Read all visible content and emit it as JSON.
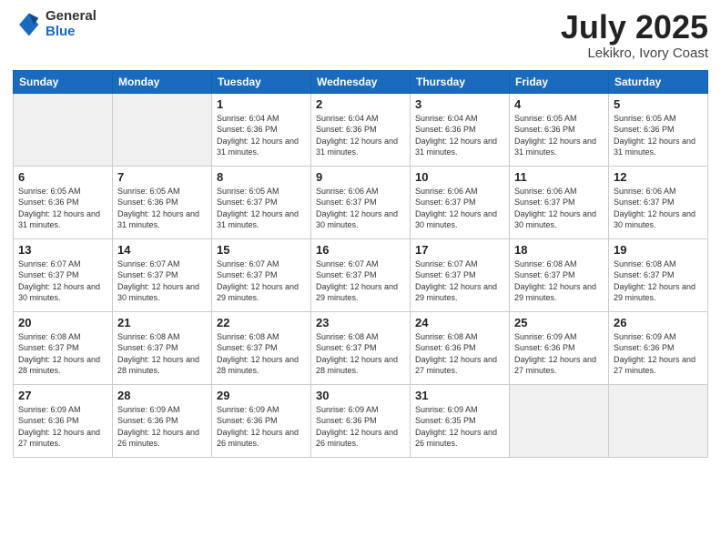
{
  "header": {
    "logo_general": "General",
    "logo_blue": "Blue",
    "title": "July 2025",
    "location": "Lekikro, Ivory Coast"
  },
  "weekdays": [
    "Sunday",
    "Monday",
    "Tuesday",
    "Wednesday",
    "Thursday",
    "Friday",
    "Saturday"
  ],
  "weeks": [
    [
      {
        "day": "",
        "empty": true
      },
      {
        "day": "",
        "empty": true
      },
      {
        "day": "1",
        "sunrise": "Sunrise: 6:04 AM",
        "sunset": "Sunset: 6:36 PM",
        "daylight": "Daylight: 12 hours and 31 minutes."
      },
      {
        "day": "2",
        "sunrise": "Sunrise: 6:04 AM",
        "sunset": "Sunset: 6:36 PM",
        "daylight": "Daylight: 12 hours and 31 minutes."
      },
      {
        "day": "3",
        "sunrise": "Sunrise: 6:04 AM",
        "sunset": "Sunset: 6:36 PM",
        "daylight": "Daylight: 12 hours and 31 minutes."
      },
      {
        "day": "4",
        "sunrise": "Sunrise: 6:05 AM",
        "sunset": "Sunset: 6:36 PM",
        "daylight": "Daylight: 12 hours and 31 minutes."
      },
      {
        "day": "5",
        "sunrise": "Sunrise: 6:05 AM",
        "sunset": "Sunset: 6:36 PM",
        "daylight": "Daylight: 12 hours and 31 minutes."
      }
    ],
    [
      {
        "day": "6",
        "sunrise": "Sunrise: 6:05 AM",
        "sunset": "Sunset: 6:36 PM",
        "daylight": "Daylight: 12 hours and 31 minutes."
      },
      {
        "day": "7",
        "sunrise": "Sunrise: 6:05 AM",
        "sunset": "Sunset: 6:36 PM",
        "daylight": "Daylight: 12 hours and 31 minutes."
      },
      {
        "day": "8",
        "sunrise": "Sunrise: 6:05 AM",
        "sunset": "Sunset: 6:37 PM",
        "daylight": "Daylight: 12 hours and 31 minutes."
      },
      {
        "day": "9",
        "sunrise": "Sunrise: 6:06 AM",
        "sunset": "Sunset: 6:37 PM",
        "daylight": "Daylight: 12 hours and 30 minutes."
      },
      {
        "day": "10",
        "sunrise": "Sunrise: 6:06 AM",
        "sunset": "Sunset: 6:37 PM",
        "daylight": "Daylight: 12 hours and 30 minutes."
      },
      {
        "day": "11",
        "sunrise": "Sunrise: 6:06 AM",
        "sunset": "Sunset: 6:37 PM",
        "daylight": "Daylight: 12 hours and 30 minutes."
      },
      {
        "day": "12",
        "sunrise": "Sunrise: 6:06 AM",
        "sunset": "Sunset: 6:37 PM",
        "daylight": "Daylight: 12 hours and 30 minutes."
      }
    ],
    [
      {
        "day": "13",
        "sunrise": "Sunrise: 6:07 AM",
        "sunset": "Sunset: 6:37 PM",
        "daylight": "Daylight: 12 hours and 30 minutes."
      },
      {
        "day": "14",
        "sunrise": "Sunrise: 6:07 AM",
        "sunset": "Sunset: 6:37 PM",
        "daylight": "Daylight: 12 hours and 30 minutes."
      },
      {
        "day": "15",
        "sunrise": "Sunrise: 6:07 AM",
        "sunset": "Sunset: 6:37 PM",
        "daylight": "Daylight: 12 hours and 29 minutes."
      },
      {
        "day": "16",
        "sunrise": "Sunrise: 6:07 AM",
        "sunset": "Sunset: 6:37 PM",
        "daylight": "Daylight: 12 hours and 29 minutes."
      },
      {
        "day": "17",
        "sunrise": "Sunrise: 6:07 AM",
        "sunset": "Sunset: 6:37 PM",
        "daylight": "Daylight: 12 hours and 29 minutes."
      },
      {
        "day": "18",
        "sunrise": "Sunrise: 6:08 AM",
        "sunset": "Sunset: 6:37 PM",
        "daylight": "Daylight: 12 hours and 29 minutes."
      },
      {
        "day": "19",
        "sunrise": "Sunrise: 6:08 AM",
        "sunset": "Sunset: 6:37 PM",
        "daylight": "Daylight: 12 hours and 29 minutes."
      }
    ],
    [
      {
        "day": "20",
        "sunrise": "Sunrise: 6:08 AM",
        "sunset": "Sunset: 6:37 PM",
        "daylight": "Daylight: 12 hours and 28 minutes."
      },
      {
        "day": "21",
        "sunrise": "Sunrise: 6:08 AM",
        "sunset": "Sunset: 6:37 PM",
        "daylight": "Daylight: 12 hours and 28 minutes."
      },
      {
        "day": "22",
        "sunrise": "Sunrise: 6:08 AM",
        "sunset": "Sunset: 6:37 PM",
        "daylight": "Daylight: 12 hours and 28 minutes."
      },
      {
        "day": "23",
        "sunrise": "Sunrise: 6:08 AM",
        "sunset": "Sunset: 6:37 PM",
        "daylight": "Daylight: 12 hours and 28 minutes."
      },
      {
        "day": "24",
        "sunrise": "Sunrise: 6:08 AM",
        "sunset": "Sunset: 6:36 PM",
        "daylight": "Daylight: 12 hours and 27 minutes."
      },
      {
        "day": "25",
        "sunrise": "Sunrise: 6:09 AM",
        "sunset": "Sunset: 6:36 PM",
        "daylight": "Daylight: 12 hours and 27 minutes."
      },
      {
        "day": "26",
        "sunrise": "Sunrise: 6:09 AM",
        "sunset": "Sunset: 6:36 PM",
        "daylight": "Daylight: 12 hours and 27 minutes."
      }
    ],
    [
      {
        "day": "27",
        "sunrise": "Sunrise: 6:09 AM",
        "sunset": "Sunset: 6:36 PM",
        "daylight": "Daylight: 12 hours and 27 minutes."
      },
      {
        "day": "28",
        "sunrise": "Sunrise: 6:09 AM",
        "sunset": "Sunset: 6:36 PM",
        "daylight": "Daylight: 12 hours and 26 minutes."
      },
      {
        "day": "29",
        "sunrise": "Sunrise: 6:09 AM",
        "sunset": "Sunset: 6:36 PM",
        "daylight": "Daylight: 12 hours and 26 minutes."
      },
      {
        "day": "30",
        "sunrise": "Sunrise: 6:09 AM",
        "sunset": "Sunset: 6:36 PM",
        "daylight": "Daylight: 12 hours and 26 minutes."
      },
      {
        "day": "31",
        "sunrise": "Sunrise: 6:09 AM",
        "sunset": "Sunset: 6:35 PM",
        "daylight": "Daylight: 12 hours and 26 minutes."
      },
      {
        "day": "",
        "empty": true
      },
      {
        "day": "",
        "empty": true
      }
    ]
  ]
}
